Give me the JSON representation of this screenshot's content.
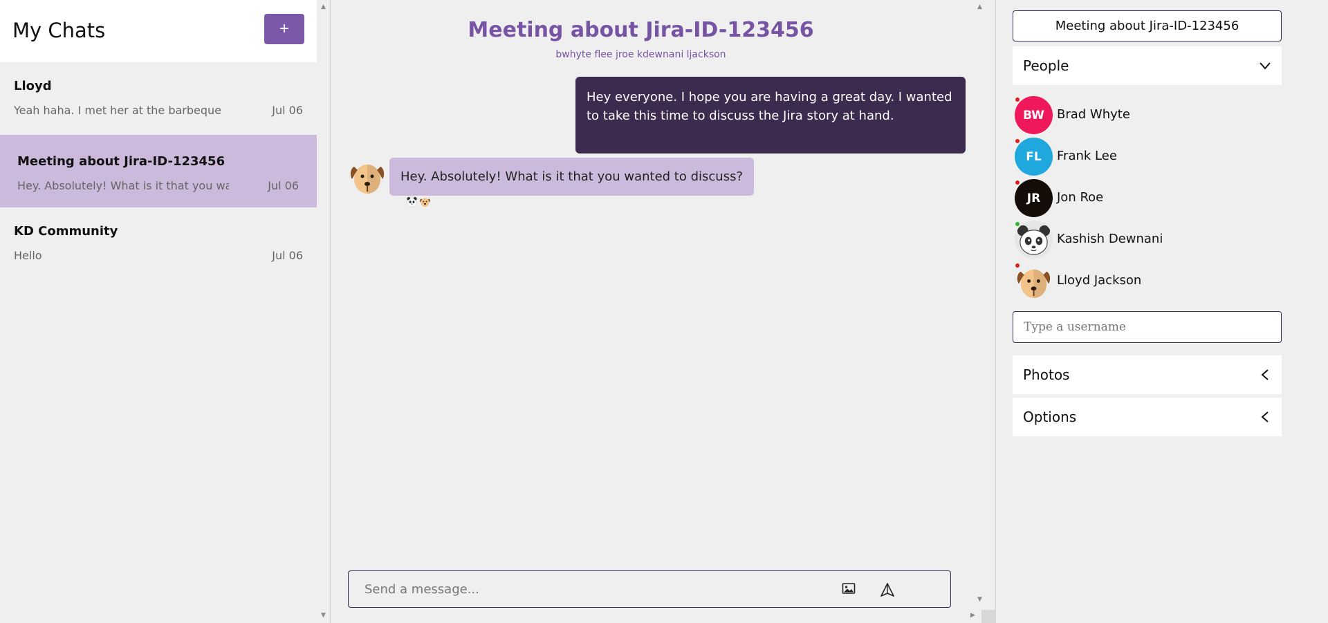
{
  "left": {
    "title": "My Chats",
    "new_chat_label": "+",
    "chats": [
      {
        "name": "Lloyd",
        "preview": "Yeah haha. I met her at the barbeque",
        "date": "Jul 06",
        "active": false
      },
      {
        "name": "Meeting about Jira-ID-123456",
        "preview": "Hey. Absolutely! What is it that you wanted to discuss?",
        "date": "Jul 06",
        "active": true
      },
      {
        "name": "KD Community",
        "preview": "Hello",
        "date": "Jul 06",
        "active": false
      }
    ]
  },
  "conversation": {
    "title": "Meeting about Jira-ID-123456",
    "members": "bwhyte flee jroe kdewnani ljackson",
    "messages": [
      {
        "direction": "out",
        "text": "Hey everyone. I hope you are having a great day. I wanted to take this time to discuss the Jira story at hand."
      },
      {
        "direction": "in",
        "sender_icon": "dog-avatar-icon",
        "text": "Hey. Absolutely! What is it that you wanted to discuss?",
        "read_by_icons": [
          "panda-avatar-icon",
          "dog-avatar-icon"
        ]
      }
    ],
    "composer": {
      "placeholder": "Send a message..."
    }
  },
  "details": {
    "title": "Meeting about Jira-ID-123456",
    "people_label": "People",
    "people": [
      {
        "initials": "BW",
        "name": "Brad Whyte",
        "color": "#f0185c",
        "status_color": "#e02020"
      },
      {
        "initials": "FL",
        "name": "Frank Lee",
        "color": "#1fa8dd",
        "status_color": "#e02020"
      },
      {
        "initials": "JR",
        "name": "Jon Roe",
        "color": "#140d08",
        "status_color": "#e02020"
      },
      {
        "initials": "",
        "name": "Kashish Dewnani",
        "icon": "panda-avatar-icon",
        "status_color": "#2fb52f"
      },
      {
        "initials": "",
        "name": "Lloyd Jackson",
        "icon": "dog-avatar-icon",
        "status_color": "#e02020"
      }
    ],
    "username_placeholder": "Type a username",
    "photos_label": "Photos",
    "options_label": "Options"
  },
  "colors": {
    "accent": "#7b58a8",
    "title_purple": "#7654a3",
    "outgoing_bubble": "#3c2a4f",
    "incoming_bubble": "#cbbadb",
    "background": "#efeff0"
  }
}
